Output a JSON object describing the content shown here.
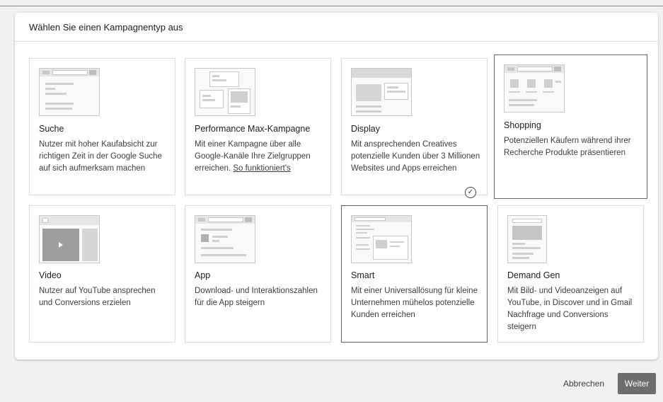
{
  "dialog": {
    "title": "Wählen Sie einen Kampagnentyp aus"
  },
  "cards": [
    {
      "id": "search",
      "title": "Suche",
      "desc": "Nutzer mit hoher Kaufabsicht zur richtigen Zeit in der Google Suche auf sich aufmerksam machen"
    },
    {
      "id": "pmax",
      "title": "Performance Max-Kampagne",
      "desc": "Mit einer Kampagne über alle Google-Kanäle Ihre Zielgruppen erreichen.",
      "link": "So funktioniert's"
    },
    {
      "id": "display",
      "title": "Display",
      "desc": "Mit ansprechenden Creatives potenzielle Kunden über 3 Millionen Websites und Apps erreichen"
    },
    {
      "id": "shopping",
      "title": "Shopping",
      "desc": "Potenziellen Käufern während ihrer Recherche Produkte präsentieren"
    },
    {
      "id": "video",
      "title": "Video",
      "desc": "Nutzer auf YouTube ansprechen und Conversions erzielen"
    },
    {
      "id": "app",
      "title": "App",
      "desc": "Download- und Interaktionszahlen für die App steigern"
    },
    {
      "id": "smart",
      "title": "Smart",
      "desc": "Mit einer Universallösung für kleine Unternehmen mühelos potenzielle Kunden erreichen"
    },
    {
      "id": "demandgen",
      "title": "Demand Gen",
      "desc": "Mit Bild- und Videoanzeigen auf YouTube, in Discover und in Gmail Nachfrage und Conversions steigern"
    }
  ],
  "selected_card": "smart",
  "icons": {
    "selected": "check-circle-icon",
    "video": "play-icon"
  },
  "footer": {
    "cancel_label": "Abbrechen",
    "next_label": "Weiter"
  }
}
